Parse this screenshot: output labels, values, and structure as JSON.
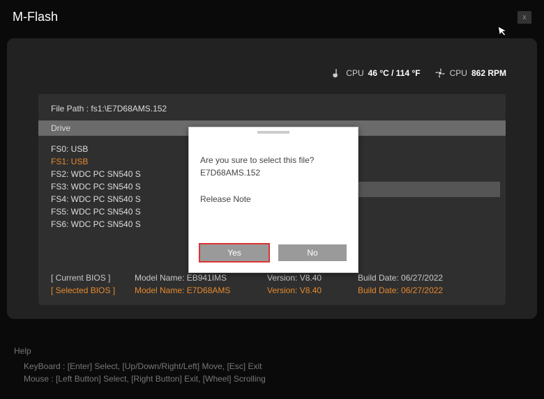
{
  "title": "M-Flash",
  "close_label": "x",
  "status": {
    "temp_label": "CPU",
    "temp_value": "46 °C / 114 °F",
    "fan_label": "CPU",
    "fan_value": "862 RPM"
  },
  "file_path_label": "File Path :",
  "file_path_value": "fs1:\\E7D68AMS.152",
  "drive_header": "Drive",
  "drives": [
    {
      "id": "FS0:",
      "name": "USB",
      "selected": false
    },
    {
      "id": "FS1:",
      "name": "USB",
      "selected": true
    },
    {
      "id": "FS2:",
      "name": "WDC PC SN540 S",
      "selected": false
    },
    {
      "id": "FS3:",
      "name": "WDC PC SN540 S",
      "selected": false
    },
    {
      "id": "FS4:",
      "name": "WDC PC SN540 S",
      "selected": false
    },
    {
      "id": "FS5:",
      "name": "WDC PC SN540 S",
      "selected": false
    },
    {
      "id": "FS6:",
      "name": "WDC PC SN540 S",
      "selected": false
    }
  ],
  "selected_file": "E7D68AMS.152",
  "bios": {
    "current_label": "[ Current BIOS  ]",
    "selected_label": "[ Selected BIOS ]",
    "current": {
      "model": "Model Name: EB941IMS",
      "version": "Version: V8.40",
      "date": "Build Date: 06/27/2022"
    },
    "selected": {
      "model": "Model Name: E7D68AMS",
      "version": "Version: V8.40",
      "date": "Build Date: 06/27/2022"
    }
  },
  "dialog": {
    "line1": "Are you sure to select this file?",
    "line2": "E7D68AMS.152",
    "note": "Release Note",
    "yes": "Yes",
    "no": "No"
  },
  "help": {
    "title": "Help",
    "keyboard": "KeyBoard :   [Enter]  Select,    [Up/Down/Right/Left]  Move,    [Esc]  Exit",
    "mouse": "Mouse     :   [Left Button]  Select,    [Right Button]  Exit,    [Wheel]  Scrolling"
  }
}
